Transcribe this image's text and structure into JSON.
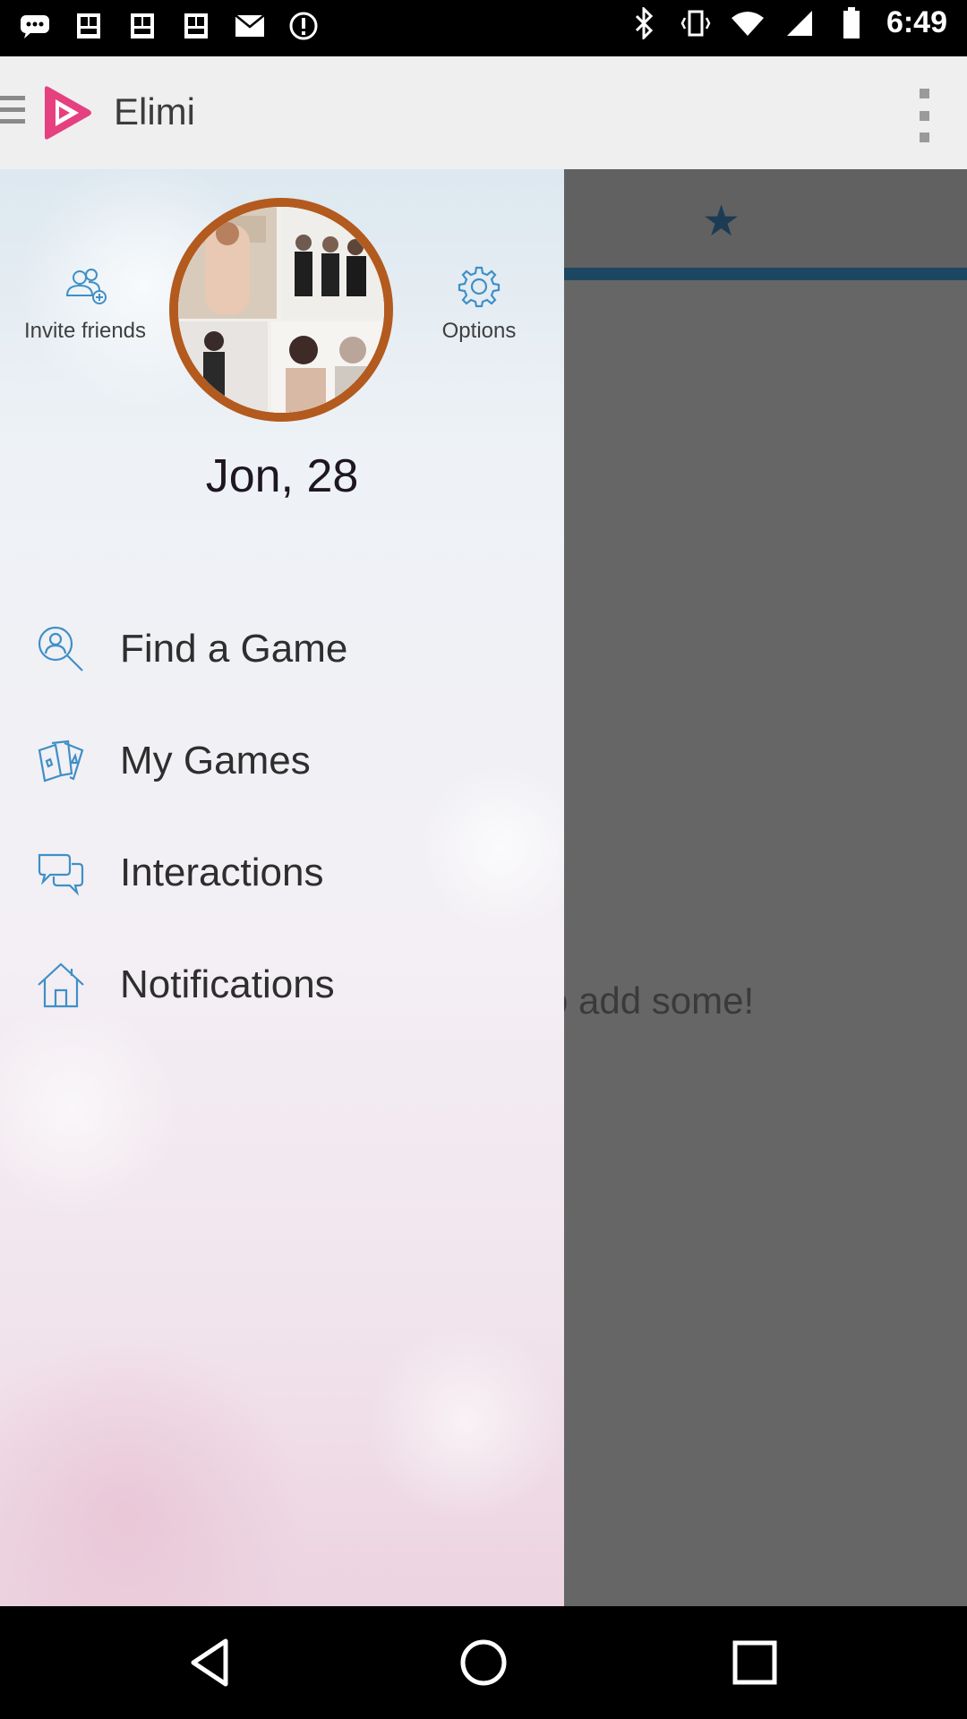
{
  "status_bar": {
    "time": "6:49",
    "icons": [
      "chat-icon",
      "photo-icon",
      "photo-icon",
      "photo-icon",
      "email-icon",
      "alert-icon",
      "bluetooth-icon",
      "vibrate-icon",
      "wifi-icon",
      "signal-icon",
      "battery-icon"
    ]
  },
  "app_bar": {
    "title": "Elimi",
    "accent_color": "#e5407f"
  },
  "drawer": {
    "invite_label": "Invite friends",
    "options_label": "Options",
    "user_name": "Jon, 28",
    "menu": [
      {
        "label": "Find a Game",
        "icon": "search-person-icon"
      },
      {
        "label": "My Games",
        "icon": "playing-cards-icon"
      },
      {
        "label": "Interactions",
        "icon": "chat-bubbles-icon"
      },
      {
        "label": "Notifications",
        "icon": "home-icon"
      }
    ],
    "icon_color": "#3f8fc6"
  },
  "content": {
    "tab_icon": "star-icon",
    "empty_text": "et. Go add some!"
  },
  "nav_bar": {
    "buttons": [
      "back-icon",
      "home-icon",
      "recents-icon"
    ]
  }
}
